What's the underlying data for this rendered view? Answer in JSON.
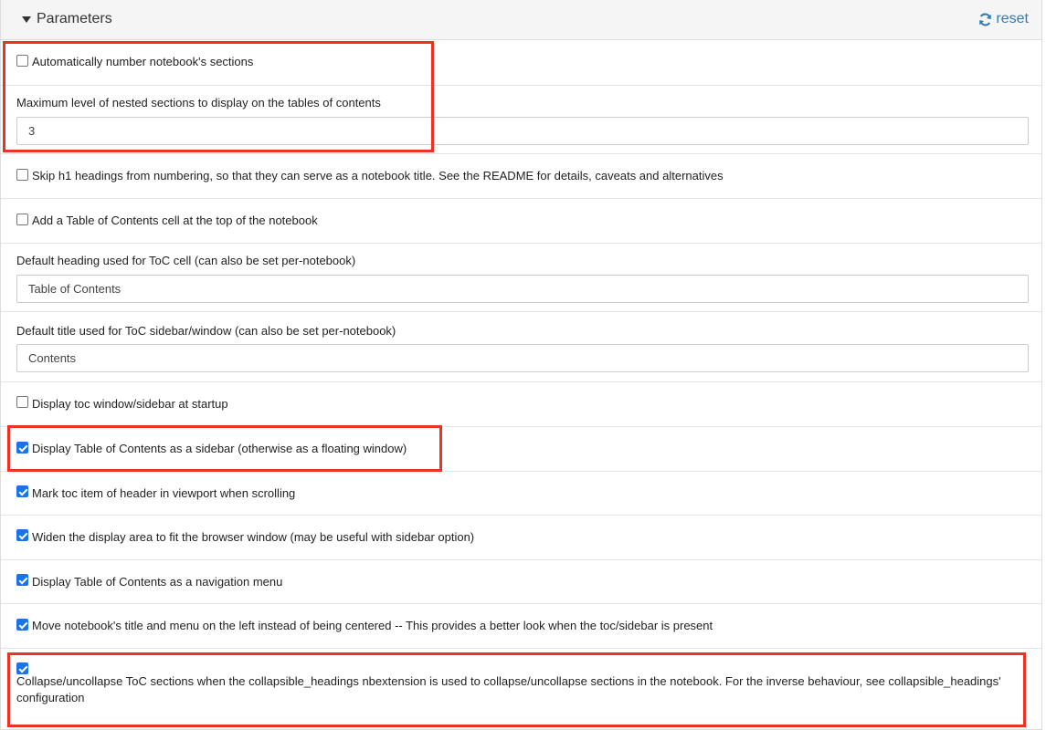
{
  "header": {
    "title": "Parameters",
    "reset_label": "reset"
  },
  "params": {
    "number_sections": {
      "label": "Automatically number notebook's sections",
      "checked": false
    },
    "max_level": {
      "label": "Maximum level of nested sections to display on the tables of contents",
      "value": "3"
    },
    "skip_h1": {
      "label": "Skip h1 headings from numbering, so that they can serve as a notebook title. See the README for details, caveats and alternatives",
      "checked": false
    },
    "toc_cell": {
      "label": "Add a Table of Contents cell at the top of the notebook",
      "checked": false
    },
    "toc_heading": {
      "label": "Default heading used for ToC cell (can also be set per-notebook)",
      "value": "Table of Contents"
    },
    "toc_title": {
      "label": "Default title used for ToC sidebar/window (can also be set per-notebook)",
      "value": "Contents"
    },
    "toc_startup": {
      "label": "Display toc window/sidebar at startup",
      "checked": false
    },
    "sidebar": {
      "label": "Display Table of Contents as a sidebar (otherwise as a floating window)",
      "checked": true
    },
    "mark_viewport": {
      "label": "Mark toc item of header in viewport when scrolling",
      "checked": true
    },
    "widen": {
      "label": "Widen the display area to fit the browser window (may be useful with sidebar option)",
      "checked": true
    },
    "nav_menu": {
      "label": "Display Table of Contents as a navigation menu",
      "checked": true
    },
    "move_title": {
      "label": "Move notebook's title and menu on the left instead of being centered -- This provides a better look when the toc/sidebar is present",
      "checked": true
    },
    "collapse": {
      "label": "Collapse/uncollapse ToC sections when the collapsible_headings nbextension is used to collapse/uncollapse sections in the notebook. For the inverse behaviour, see collapsible_headings' configuration",
      "checked": true
    }
  },
  "colors": {
    "highlight": "#ea3323",
    "link": "#337ab7",
    "checkbox": "#1a73e8"
  }
}
